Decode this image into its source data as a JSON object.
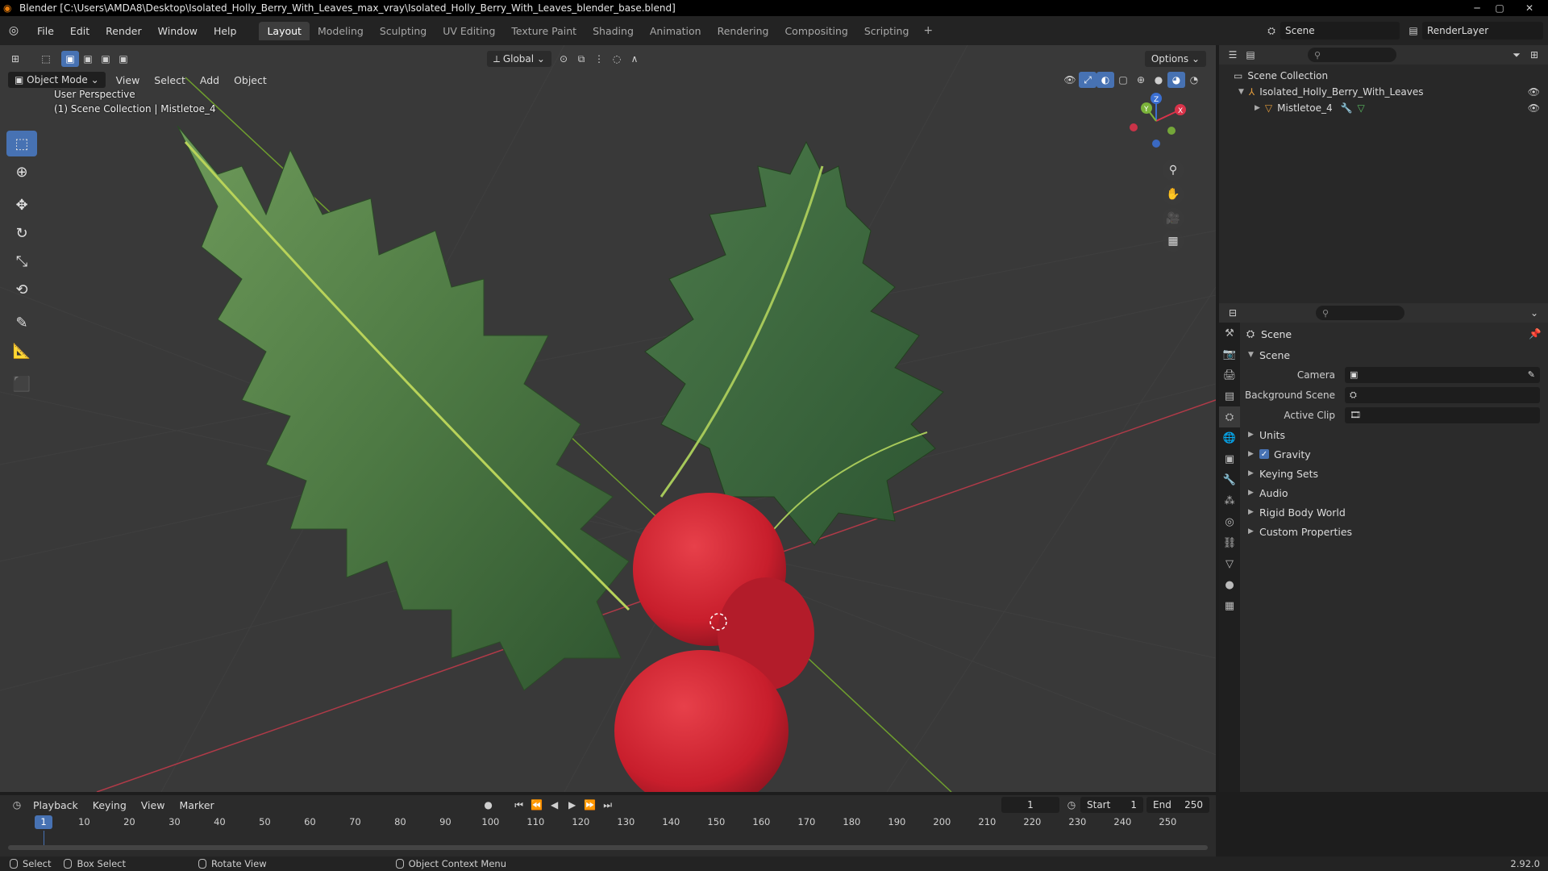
{
  "window": {
    "title": "Blender [C:\\Users\\AMDA8\\Desktop\\Isolated_Holly_Berry_With_Leaves_max_vray\\Isolated_Holly_Berry_With_Leaves_blender_base.blend]"
  },
  "menu": [
    "File",
    "Edit",
    "Render",
    "Window",
    "Help"
  ],
  "workspaces": [
    "Layout",
    "Modeling",
    "Sculpting",
    "UV Editing",
    "Texture Paint",
    "Shading",
    "Animation",
    "Rendering",
    "Compositing",
    "Scripting"
  ],
  "active_workspace": "Layout",
  "scene_name": "Scene",
  "view_layer": "RenderLayer",
  "viewport": {
    "mode": "Object Mode",
    "menus": [
      "View",
      "Select",
      "Add",
      "Object"
    ],
    "transform_orientation": "Global",
    "options_label": "Options",
    "info_line1": "User Perspective",
    "info_line2": "(1) Scene Collection | Mistletoe_4",
    "gizmo_axes": {
      "x": "X",
      "y": "Y",
      "z": "Z"
    }
  },
  "outliner": {
    "root": "Scene Collection",
    "collection": "Isolated_Holly_Berry_With_Leaves",
    "object": "Mistletoe_4"
  },
  "properties": {
    "context_title": "Scene",
    "panel_title": "Scene",
    "camera_label": "Camera",
    "background_scene_label": "Background Scene",
    "active_clip_label": "Active Clip",
    "panels": [
      "Units",
      "Gravity",
      "Keying Sets",
      "Audio",
      "Rigid Body World",
      "Custom Properties"
    ],
    "gravity_checked": true
  },
  "timeline": {
    "menus": [
      "Playback",
      "Keying",
      "View",
      "Marker"
    ],
    "current_frame": "1",
    "start_label": "Start",
    "start_value": "1",
    "end_label": "End",
    "end_value": "250",
    "ticks": [
      "10",
      "20",
      "30",
      "40",
      "50",
      "60",
      "70",
      "80",
      "90",
      "100",
      "110",
      "120",
      "130",
      "140",
      "150",
      "160",
      "170",
      "180",
      "190",
      "200",
      "210",
      "220",
      "230",
      "240",
      "250"
    ],
    "playhead_label": "1"
  },
  "statusbar": {
    "select": "Select",
    "box_select": "Box Select",
    "rotate_view": "Rotate View",
    "context_menu": "Object Context Menu",
    "version": "2.92.0"
  }
}
